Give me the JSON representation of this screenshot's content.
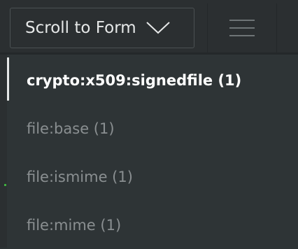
{
  "header": {
    "scroll_button_label": "Scroll to Form",
    "chevron_icon": "chevron-down-icon",
    "menu_icon": "hamburger-menu-icon"
  },
  "list": {
    "items": [
      {
        "label": "crypto:x509:signedfile (1)",
        "active": true
      },
      {
        "label": "file:base (1)",
        "active": false
      },
      {
        "label": "file:ismime (1)",
        "active": false
      },
      {
        "label": "file:mime (1)",
        "active": false
      }
    ]
  },
  "colors": {
    "background": "#2e3436",
    "active_text": "#ffffff",
    "inactive_text": "#8a8f91",
    "accent_mark": "#3fae3f"
  }
}
